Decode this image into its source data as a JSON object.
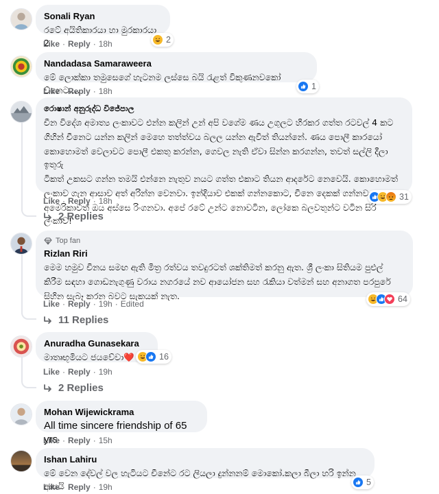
{
  "comments": [
    {
      "author": "Sonali Ryan",
      "text": [
        "රටේ අයිතිකාරයා හා මුරකාරයා 2"
      ],
      "reactions": [
        "haha"
      ],
      "reaction_count": "2",
      "like_label": "Like",
      "reply_label": "Reply",
      "time": "18h"
    },
    {
      "author": "Nandadasa Samaraweera",
      "text": [
        "මේ ලොක්කා තමුසෙගේ හැටනම ලස්සෙ බයි රැළත් විකුණනවකෝ ව්නෙට...."
      ],
      "reactions": [
        "like"
      ],
      "reaction_count": "1",
      "like_label": "Like",
      "reply_label": "Reply",
      "time": "18h"
    },
    {
      "author": "රොෂාන් අනුරුද්ධ විජේපාල",
      "text": [
        "චීන විදේශ අමාත්‍ය ලංකාවට එන්න කලින් උන් අපි වගේම ණය උගුලට හිරකර ගත්ත රටවල් 4 කට",
        "ගිහින් චීනෙට යන්න කලින් මෙහෙ තත්ත්වය බලල යන්න ඇවිත් තියන්නේ. ණය පොලී කාරයෝ",
        "කොහොමත් වෙලාවට පොලී එකතු කරන්න, ගෙවල නැති ඒවා සින්න කරගන්න, තවත් සල්ලි දීලා ඉතුරු",
        "ටිකත් උකසට ගන්න තමයි එන්නෙ නැතුව නයට ගත්ත එකාට තියන ආදරේට නෙවෙයි. කොහොමත්",
        "ලංකාව ගැන ආසාව අත් අරින්න වෙනවා. ඉන්දියාව එකක් ගන්නකොට, චීනෙ දෙකක් ගන්නවා,",
        "අමෙරිකාවත් ඔය අස්සෙ රිංගනවා. අපේ රටේ උන්ට නොවටින, ලෝකෙ බලවතුන්ට වටින සිරි ලංකාව!"
      ],
      "reactions": [
        "like",
        "haha",
        "angry"
      ],
      "reaction_count": "31",
      "like_label": "Like",
      "reply_label": "Reply",
      "time": "18h",
      "replies_label": "2 Replies"
    },
    {
      "top_fan": "Top fan",
      "author": "Rizlan Riri",
      "text": [
        "මෙම හමුව චීනය සමඟ ඇති මිත්‍ර රත්වය තවදුරටත් ශක්තිමත් කරනු ඇත. ශ්‍රී ලංකා සිතියම පුළුල්",
        "කිරීම සඳහා ගොඩනැගුණු වරාය නගරයේ නව ආයෝජන සහ රැකියා වත්මන් සහ අනාගත පරපුරේ",
        "සිහින සැබෑ කරන බවට සැකයක් නැත."
      ],
      "reactions": [
        "haha",
        "like",
        "love"
      ],
      "reaction_count": "64",
      "like_label": "Like",
      "reply_label": "Reply",
      "time": "19h",
      "edited": "Edited",
      "replies_label": "11 Replies"
    },
    {
      "author": "Anuradha Gunasekara",
      "text": [
        "මාතෘභූමියට ජයවේවා❤️"
      ],
      "reactions": [
        "haha",
        "like"
      ],
      "reaction_count": "16",
      "like_label": "Like",
      "reply_label": "Reply",
      "time": "19h",
      "replies_label": "2 Replies"
    },
    {
      "author": "Mohan Wijewickrama",
      "text": [
        "All time sincere friendship of 65 yrs"
      ],
      "like_label": "Like",
      "reply_label": "Reply",
      "time": "15h"
    },
    {
      "author": "Ishan Lahiru",
      "text": [
        "මේ වෙන දේවල් වල හැටියට චීනේට රට ලියලා දුන්නනම් මොකෝ.කලා බීලා හරි ඉන්න ආසයි"
      ],
      "reactions": [
        "like"
      ],
      "reaction_count": "5",
      "like_label": "Like",
      "reply_label": "Reply",
      "time": "19h"
    }
  ],
  "colors": {
    "bubble": "#f0f2f5",
    "meta": "#65676b",
    "like_blue": "#1877f2",
    "love_red": "#f33e58",
    "haha_yellow": "#f7b928"
  }
}
